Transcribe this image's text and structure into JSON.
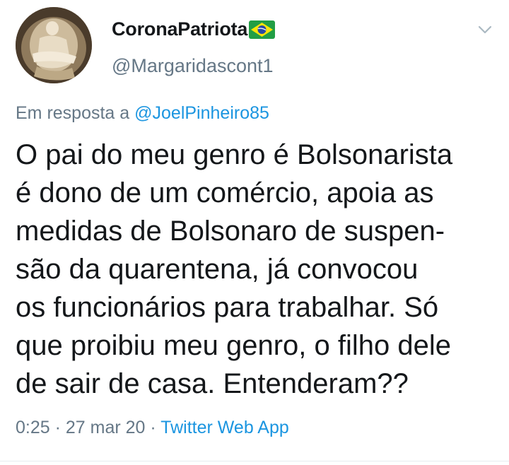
{
  "tweet": {
    "display_name": "CoronaPatriota",
    "handle": "@Margaridascont1",
    "reply_prefix": "Em resposta a",
    "reply_mention": "@JoelPinheiro85",
    "body_lines": [
      "O pai do meu genro é Bolsonarista",
      "é dono de um comércio, apoia as",
      "medidas de Bolsonaro de suspen-",
      "são da quarentena, já convocou",
      "os funcionários para trabalhar. Só",
      "que proibiu meu genro, o filho dele",
      "de sair de casa. Entenderam??"
    ],
    "time": "0:25",
    "separator": " · ",
    "date": "27 mar 20",
    "source": "Twitter Web App"
  },
  "icons": {
    "flag": "brazil-flag-icon",
    "menu": "chevron-down-icon",
    "avatar": "avatar"
  },
  "colors": {
    "text_primary": "#14171a",
    "text_secondary": "#657786",
    "link": "#1b95e0",
    "divider": "#e6ecf0"
  }
}
